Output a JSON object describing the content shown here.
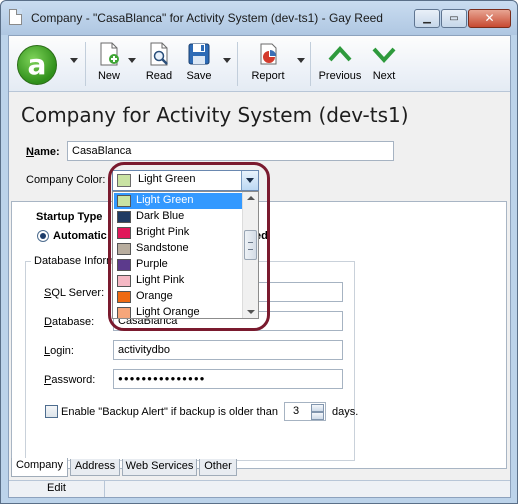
{
  "window": {
    "title": "Company - \"CasaBlanca\" for Activity System (dev-ts1) - Gay Reed",
    "close_glyph": "✕",
    "min_glyph": "▁",
    "max_glyph": "▭"
  },
  "toolbar": {
    "logo_glyph": "a",
    "new_label": "New",
    "read_label": "Read",
    "save_label": "Save",
    "report_label": "Report",
    "previous_label": "Previous",
    "next_label": "Next"
  },
  "page": {
    "title": "Company for Activity System (dev-ts1)"
  },
  "form": {
    "name_label_key": "N",
    "name_label_rest": "ame:",
    "name_value": "CasaBlanca",
    "color_label": "Company Color:",
    "color_value": "Light Green",
    "color_swatch": "#c9e3a3"
  },
  "startup": {
    "label": "Startup Type",
    "automatic_label": "Automatic",
    "other_label": "ed"
  },
  "database": {
    "legend": "Database Information",
    "sql_label_key": "S",
    "sql_label_rest": "QL Server:",
    "db_label_key": "D",
    "db_label_rest": "atabase:",
    "db_value": "CasaBlanca",
    "login_label_key": "L",
    "login_label_rest": "ogin:",
    "login_value": "activitydbo",
    "password_label_key": "P",
    "password_label_rest": "assword:",
    "password_value": "●●●●●●●●●●●●●●●"
  },
  "backup": {
    "label": "Enable \"Backup Alert\" if backup is older than",
    "days_value": "3",
    "days_label": "days."
  },
  "dropdown": {
    "items": [
      {
        "label": "Light Green",
        "color": "#c9e3a3"
      },
      {
        "label": "Dark Blue",
        "color": "#1f3b63"
      },
      {
        "label": "Bright Pink",
        "color": "#e0185a"
      },
      {
        "label": "Sandstone",
        "color": "#b8ad9e"
      },
      {
        "label": "Purple",
        "color": "#5c3a8c"
      },
      {
        "label": "Light Pink",
        "color": "#f5b8c4"
      },
      {
        "label": "Orange",
        "color": "#ef6a12"
      },
      {
        "label": "Light Orange",
        "color": "#f6a67a"
      }
    ]
  },
  "tabs": [
    {
      "label": "Company"
    },
    {
      "label": "Address"
    },
    {
      "label": "Web Services"
    },
    {
      "label": "Other"
    }
  ],
  "status": {
    "mode": "Edit"
  },
  "colors": {
    "highlight": "#3399ff",
    "ring": "#7a1a2e",
    "logo_green": "#2f8f1a",
    "nav_green": "#2e9a3c"
  }
}
